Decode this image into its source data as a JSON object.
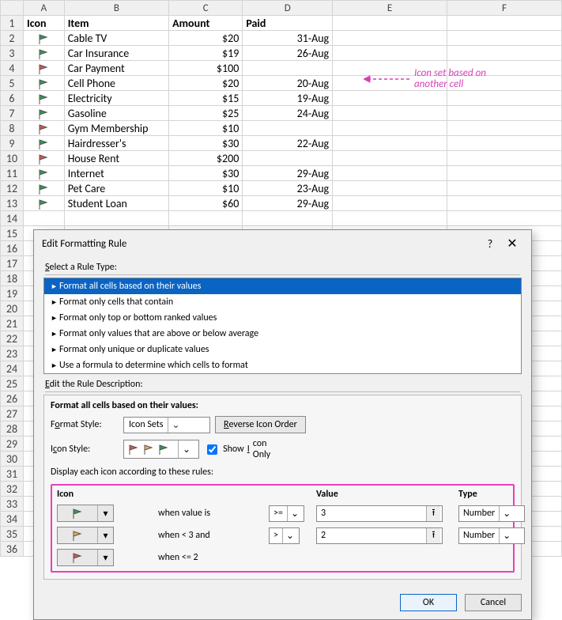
{
  "columns": [
    "A",
    "B",
    "C",
    "D",
    "E",
    "F"
  ],
  "headerRow": {
    "icon": "Icon",
    "item": "Item",
    "amount": "Amount",
    "paid": "Paid"
  },
  "rows": [
    {
      "flag": "green",
      "item": "Cable TV",
      "amount": "$20",
      "paid": "31-Aug"
    },
    {
      "flag": "green",
      "item": "Car Insurance",
      "amount": "$19",
      "paid": "26-Aug"
    },
    {
      "flag": "red",
      "item": "Car Payment",
      "amount": "$100",
      "paid": ""
    },
    {
      "flag": "green",
      "item": "Cell Phone",
      "amount": "$20",
      "paid": "20-Aug"
    },
    {
      "flag": "green",
      "item": "Electricity",
      "amount": "$15",
      "paid": "19-Aug"
    },
    {
      "flag": "green",
      "item": "Gasoline",
      "amount": "$25",
      "paid": "24-Aug"
    },
    {
      "flag": "red",
      "item": "Gym Membership",
      "amount": "$10",
      "paid": ""
    },
    {
      "flag": "green",
      "item": "Hairdresser's",
      "amount": "$30",
      "paid": "22-Aug"
    },
    {
      "flag": "red",
      "item": "House Rent",
      "amount": "$200",
      "paid": ""
    },
    {
      "flag": "green",
      "item": "Internet",
      "amount": "$30",
      "paid": "29-Aug"
    },
    {
      "flag": "green",
      "item": "Pet Care",
      "amount": "$10",
      "paid": "23-Aug"
    },
    {
      "flag": "green",
      "item": "Student Loan",
      "amount": "$60",
      "paid": "29-Aug"
    }
  ],
  "annotation": {
    "line1": "Icon set based on",
    "line2": "another cell"
  },
  "dialog": {
    "title": "Edit Formatting Rule",
    "select_label": "Select a Rule Type:",
    "rule_types": [
      "Format all cells based on their values",
      "Format only cells that contain",
      "Format only top or bottom ranked values",
      "Format only values that are above or below average",
      "Format only unique or duplicate values",
      "Use a formula to determine which cells to format"
    ],
    "edit_label": "Edit the Rule Description:",
    "desc_header": "Format all cells based on their values:",
    "format_style_lbl": "Format Style:",
    "format_style": "Icon Sets",
    "reverse_btn": "Reverse Icon Order",
    "icon_style_lbl": "Icon Style:",
    "show_icon_only": "Show Icon Only",
    "display_lbl": "Display each icon according to these rules:",
    "cols": {
      "icon": "Icon",
      "value": "Value",
      "type": "Type"
    },
    "rules": [
      {
        "flag": "green",
        "text": "when value is",
        "op": ">=",
        "val": "3",
        "type": "Number"
      },
      {
        "flag": "yellow",
        "text": "when < 3 and",
        "op": ">",
        "val": "2",
        "type": "Number"
      },
      {
        "flag": "red",
        "text": "when <= 2"
      }
    ],
    "ok": "OK",
    "cancel": "Cancel"
  }
}
